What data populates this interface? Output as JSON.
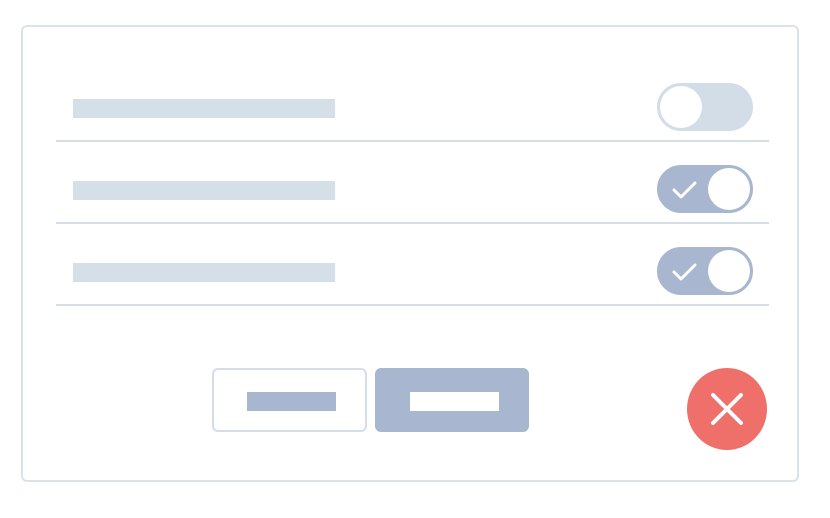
{
  "settings": {
    "rows": [
      {
        "enabled": false
      },
      {
        "enabled": true
      },
      {
        "enabled": true
      }
    ]
  },
  "buttons": {
    "secondary": {
      "label": ""
    },
    "primary": {
      "label": ""
    }
  },
  "icons": {
    "toggle_check": "check-icon",
    "close": "close-icon"
  },
  "colors": {
    "accent": "#a8b7cf",
    "toggle_off": "#d3dde7",
    "placeholder": "#d5dfe8",
    "border": "#dbe2ea",
    "danger": "#ef6f6a",
    "surface": "#ffffff"
  }
}
